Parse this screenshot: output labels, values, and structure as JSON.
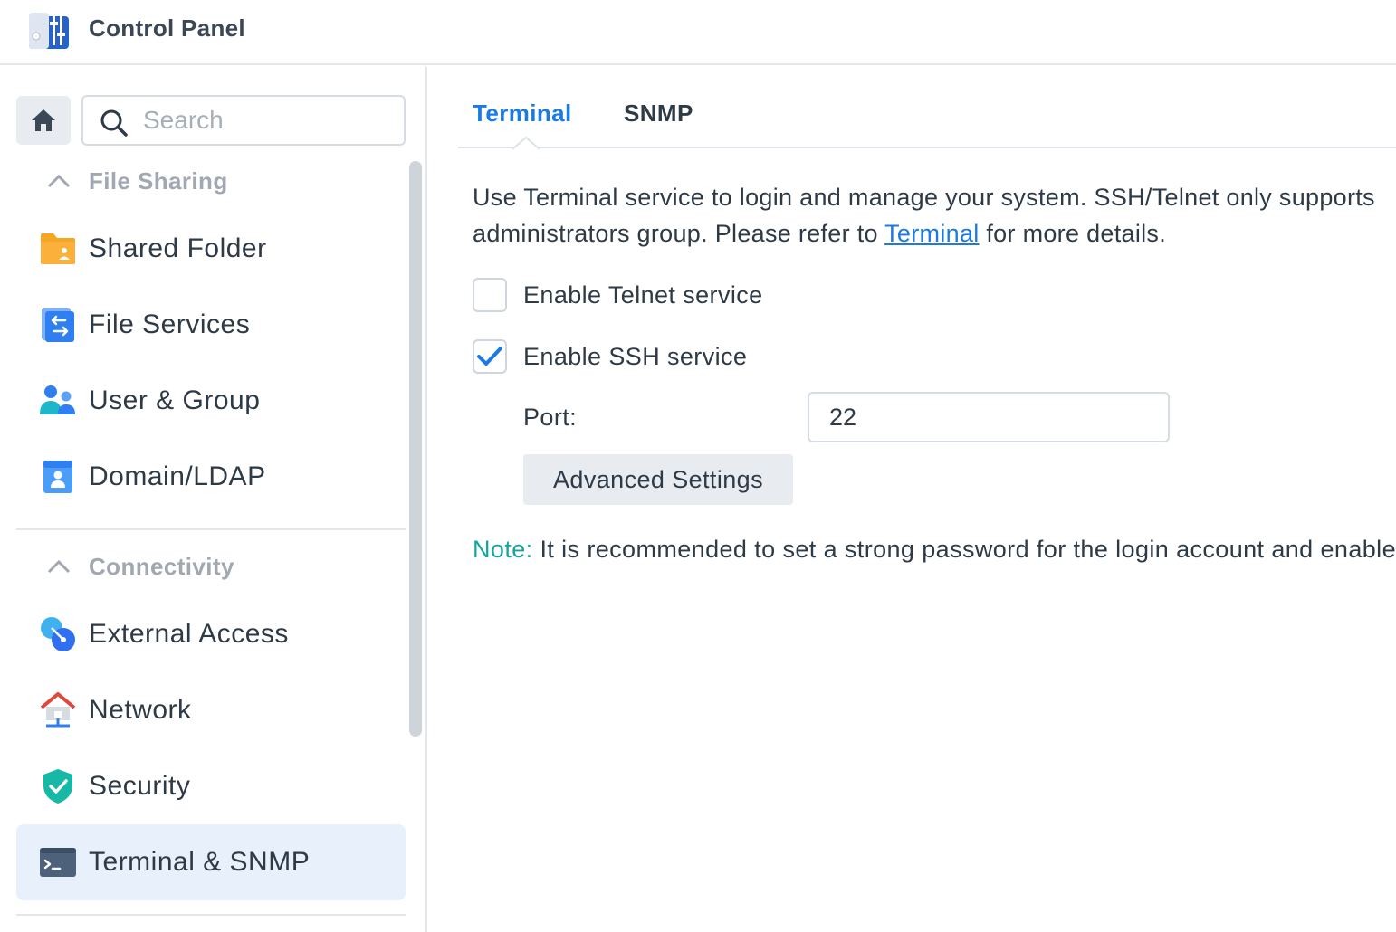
{
  "window": {
    "title": "Control Panel",
    "icon": "control-panel-icon"
  },
  "sidebar": {
    "home_icon": "home-icon",
    "search": {
      "placeholder": "Search",
      "value": ""
    },
    "sections": [
      {
        "label": "File Sharing",
        "items": [
          {
            "label": "Shared Folder",
            "icon": "shared-folder-icon"
          },
          {
            "label": "File Services",
            "icon": "file-services-icon"
          },
          {
            "label": "User & Group",
            "icon": "user-group-icon"
          },
          {
            "label": "Domain/LDAP",
            "icon": "domain-ldap-icon"
          }
        ]
      },
      {
        "label": "Connectivity",
        "items": [
          {
            "label": "External Access",
            "icon": "external-access-icon"
          },
          {
            "label": "Network",
            "icon": "network-icon"
          },
          {
            "label": "Security",
            "icon": "security-shield-icon"
          },
          {
            "label": "Terminal & SNMP",
            "icon": "terminal-icon",
            "active": true
          }
        ]
      }
    ]
  },
  "main": {
    "tabs": [
      {
        "label": "Terminal",
        "active": true
      },
      {
        "label": "SNMP",
        "active": false
      }
    ],
    "description": {
      "line1": "Use Terminal service to login and manage your system. SSH/Telnet only supports",
      "line2_before": "administrators group. Please refer to ",
      "link": "Terminal",
      "line2_after": " for more details."
    },
    "telnet": {
      "label": "Enable Telnet service",
      "checked": false
    },
    "ssh": {
      "label": "Enable SSH service",
      "checked": true
    },
    "port": {
      "label": "Port:",
      "value": "22"
    },
    "advanced_button": "Advanced Settings",
    "note": {
      "key": "Note:",
      "text": " It is recommended to set a strong password for the login account and enable"
    }
  },
  "colors": {
    "accent": "#1a7be6",
    "note": "#16a3a0",
    "active_item_bg": "#e8f0fb",
    "text": "#2f3a47"
  }
}
